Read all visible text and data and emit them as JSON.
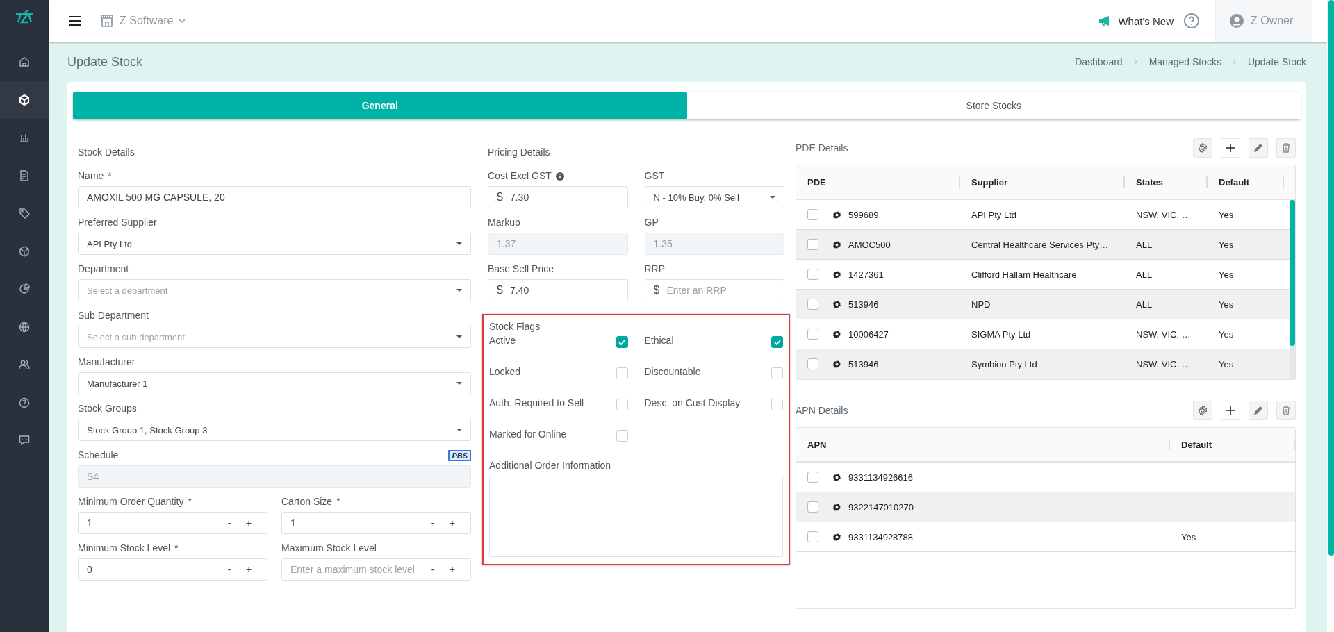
{
  "sidebar": {
    "items": [
      {
        "selected": false
      },
      {
        "selected": true
      },
      {
        "selected": false
      },
      {
        "selected": false
      },
      {
        "selected": false
      },
      {
        "selected": false
      },
      {
        "selected": false
      },
      {
        "selected": false
      },
      {
        "selected": false
      },
      {
        "selected": false
      },
      {
        "selected": false
      }
    ]
  },
  "topbar": {
    "store": "Z Software",
    "whats_new": "What's New",
    "user": "Z Owner"
  },
  "page": {
    "title": "Update Stock",
    "breadcrumbs": [
      "Dashboard",
      "Managed Stocks",
      "Update Stock"
    ]
  },
  "tabs": [
    {
      "label": "General",
      "selected": true
    },
    {
      "label": "Store Stocks",
      "selected": false
    }
  ],
  "stock_details": {
    "heading": "Stock Details",
    "fields": [
      {
        "kind": "text",
        "label": "Name",
        "required": "*",
        "value": "AMOXIL 500 MG CAPSULE, 20"
      },
      {
        "kind": "select",
        "label": "Preferred Supplier",
        "value": "API Pty Ltd"
      },
      {
        "kind": "select",
        "label": "Department",
        "placeholder": "Select a department"
      },
      {
        "kind": "select",
        "label": "Sub Department",
        "placeholder": "Select a sub department"
      },
      {
        "kind": "select",
        "label": "Manufacturer",
        "value": "Manufacturer 1"
      },
      {
        "kind": "select",
        "label": "Stock Groups",
        "value": "Stock Group 1, Stock Group 3"
      },
      {
        "kind": "readonly",
        "label": "Schedule",
        "badge": "PBS",
        "value": "S4"
      }
    ],
    "steppers": [
      {
        "label": "Minimum Order Quantity",
        "required": "*",
        "value": "1",
        "minus": "-",
        "plus": "+"
      },
      {
        "label": "Carton Size",
        "required": "*",
        "value": "1",
        "minus": "-",
        "plus": "+"
      },
      {
        "label": "Minimum Stock Level",
        "required": "*",
        "value": "0",
        "minus": "-",
        "plus": "+"
      },
      {
        "label": "Maximum Stock Level",
        "placeholder": "Enter a maximum stock level",
        "minus": "-",
        "plus": "+"
      }
    ]
  },
  "pricing": {
    "heading": "Pricing Details",
    "fields": [
      {
        "kind": "currency",
        "label": "Cost Excl GST",
        "info": true,
        "prefix": "$",
        "value": "7.30"
      },
      {
        "kind": "select",
        "label": "GST",
        "value": "N - 10% Buy, 0% Sell"
      },
      {
        "kind": "readonly",
        "label": "Markup",
        "value": "1.37"
      },
      {
        "kind": "readonly",
        "label": "GP",
        "value": "1.35"
      },
      {
        "kind": "currency",
        "label": "Base Sell Price",
        "prefix": "$",
        "value": "7.40"
      },
      {
        "kind": "currency",
        "label": "RRP",
        "prefix": "$",
        "placeholder": "Enter an RRP"
      }
    ]
  },
  "stock_flags": {
    "highlighted": true,
    "heading": "Stock Flags",
    "flags": [
      {
        "label": "Active",
        "checked": true
      },
      {
        "label": "Ethical",
        "checked": true
      },
      {
        "label": "Locked",
        "checked": false
      },
      {
        "label": "Discountable",
        "checked": false
      },
      {
        "label": "Auth. Required to Sell",
        "checked": false
      },
      {
        "label": "Desc. on Cust Display",
        "checked": false
      },
      {
        "label": "Marked for Online",
        "checked": false
      }
    ],
    "notes_label": "Additional Order Information"
  },
  "pde": {
    "heading": "PDE Details",
    "columns": [
      "PDE",
      "Supplier",
      "States",
      "Default"
    ],
    "rows": [
      {
        "checked": false,
        "pde": "599689",
        "supplier": "API Pty Ltd",
        "states": "NSW, VIC, …",
        "default": "Yes"
      },
      {
        "checked": false,
        "pde": "AMOC500",
        "supplier": "Central Healthcare Services Pty…",
        "states": "ALL",
        "default": "Yes"
      },
      {
        "checked": false,
        "pde": "1427361",
        "supplier": "Clifford Hallam Healthcare",
        "states": "ALL",
        "default": "Yes"
      },
      {
        "checked": false,
        "pde": "513946",
        "supplier": "NPD",
        "states": "ALL",
        "default": "Yes"
      },
      {
        "checked": false,
        "pde": "10006427",
        "supplier": "SIGMA Pty Ltd",
        "states": "NSW, VIC, …",
        "default": "Yes"
      },
      {
        "checked": false,
        "pde": "513946",
        "supplier": "Symbion Pty Ltd",
        "states": "NSW, VIC, …",
        "default": "Yes"
      }
    ]
  },
  "apn": {
    "heading": "APN Details",
    "columns": [
      "APN",
      "Default"
    ],
    "rows": [
      {
        "checked": false,
        "apn": "9331134926616"
      },
      {
        "checked": false,
        "apn": "9322147010270"
      },
      {
        "checked": false,
        "apn": "9331134928788",
        "default": "Yes"
      }
    ]
  }
}
